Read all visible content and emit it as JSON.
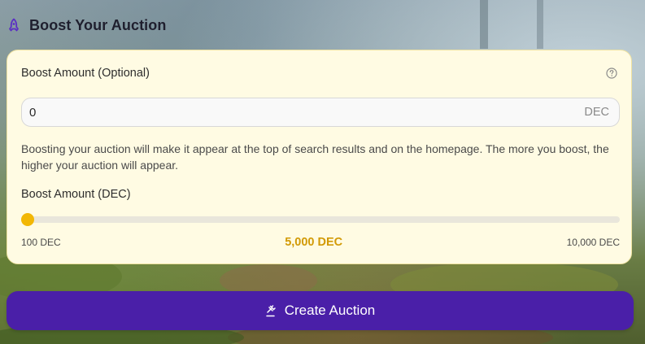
{
  "section": {
    "title": "Boost Your Auction",
    "icon": "rocket-icon",
    "icon_color": "#5b2fc4"
  },
  "boost_amount": {
    "label": "Boost Amount (Optional)",
    "help_icon": "question-circle-icon",
    "value": "0",
    "unit": "DEC"
  },
  "description": "Boosting your auction will make it appear at the top of search results and on the homepage. The more you boost, the higher your auction will appear.",
  "slider": {
    "label": "Boost Amount (DEC)",
    "min_label": "100 DEC",
    "current_label": "5,000 DEC",
    "max_label": "10,000 DEC",
    "min": 100,
    "max": 10000,
    "value": 100,
    "accent_color": "#f2b705"
  },
  "create_button": {
    "label": "Create Auction",
    "icon": "gavel-icon",
    "color": "#4a1fa8"
  }
}
